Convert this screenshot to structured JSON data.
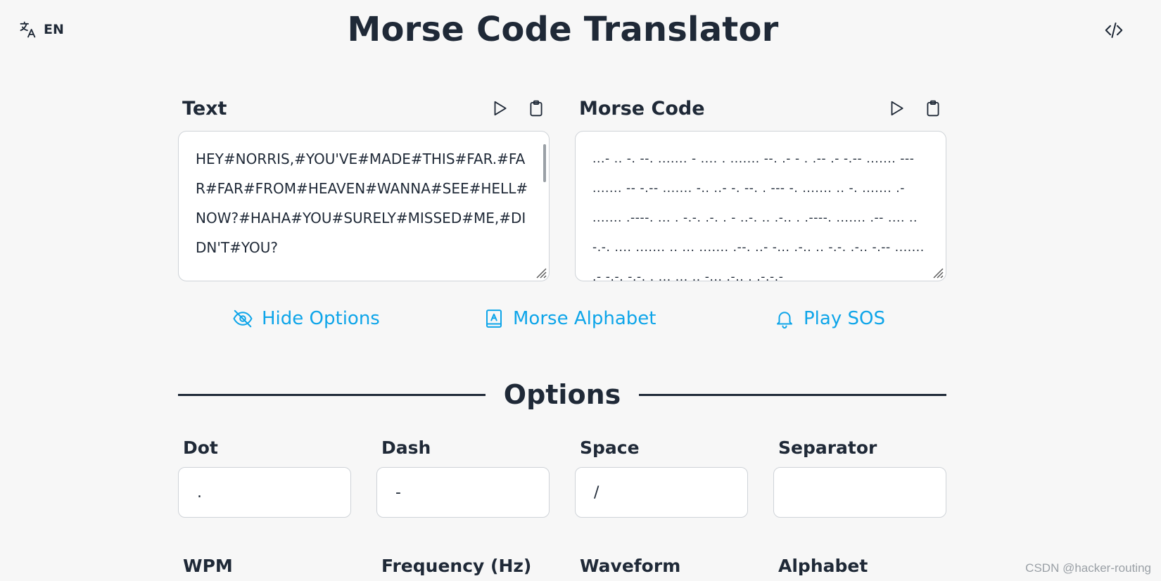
{
  "header": {
    "lang_code": "EN",
    "title": "Morse Code Translator"
  },
  "text_panel": {
    "label": "Text",
    "content": "HEY#NORRIS,#YOU'VE#MADE#THIS#FAR.#FAR#FAR#FROM#HEAVEN#WANNA#SEE#HELL#NOW?#HAHA#YOU#SURELY#MISSED#ME,#DIDN'T#YOU?"
  },
  "morse_panel": {
    "label": "Morse Code",
    "content": "...- .. -. --. ....... - .... . ....... --. .- - . .-- .- -.-- ....... ---  ....... -- -.-- ....... -.. ..- -. --. . --- -. ....... .. -. ....... .- ....... .----. ... . -.-. .-. . - ..-. .. .-.. . .----. ....... .-- .... .. -.-. .... ....... .. ... ....... .--. ..- -... .-.. .. -.-. .-.. -.-- ....... .- -.-. -.-. . ... ... .. -... .-.. . .-.-.-"
  },
  "actions": {
    "hide_options": "Hide Options",
    "morse_alphabet": "Morse Alphabet",
    "play_sos": "Play SOS"
  },
  "options": {
    "heading": "Options",
    "dot": {
      "label": "Dot",
      "value": "."
    },
    "dash": {
      "label": "Dash",
      "value": "-"
    },
    "space": {
      "label": "Space",
      "value": "/"
    },
    "separator": {
      "label": "Separator",
      "value": ""
    },
    "wpm": {
      "label": "WPM"
    },
    "frequency": {
      "label": "Frequency (Hz)"
    },
    "waveform": {
      "label": "Waveform"
    },
    "alphabet": {
      "label": "Alphabet"
    }
  },
  "watermark": "CSDN @hacker-routing",
  "colors": {
    "accent": "#0ea5e9",
    "text": "#1f2937",
    "background": "#f7f7f7"
  }
}
